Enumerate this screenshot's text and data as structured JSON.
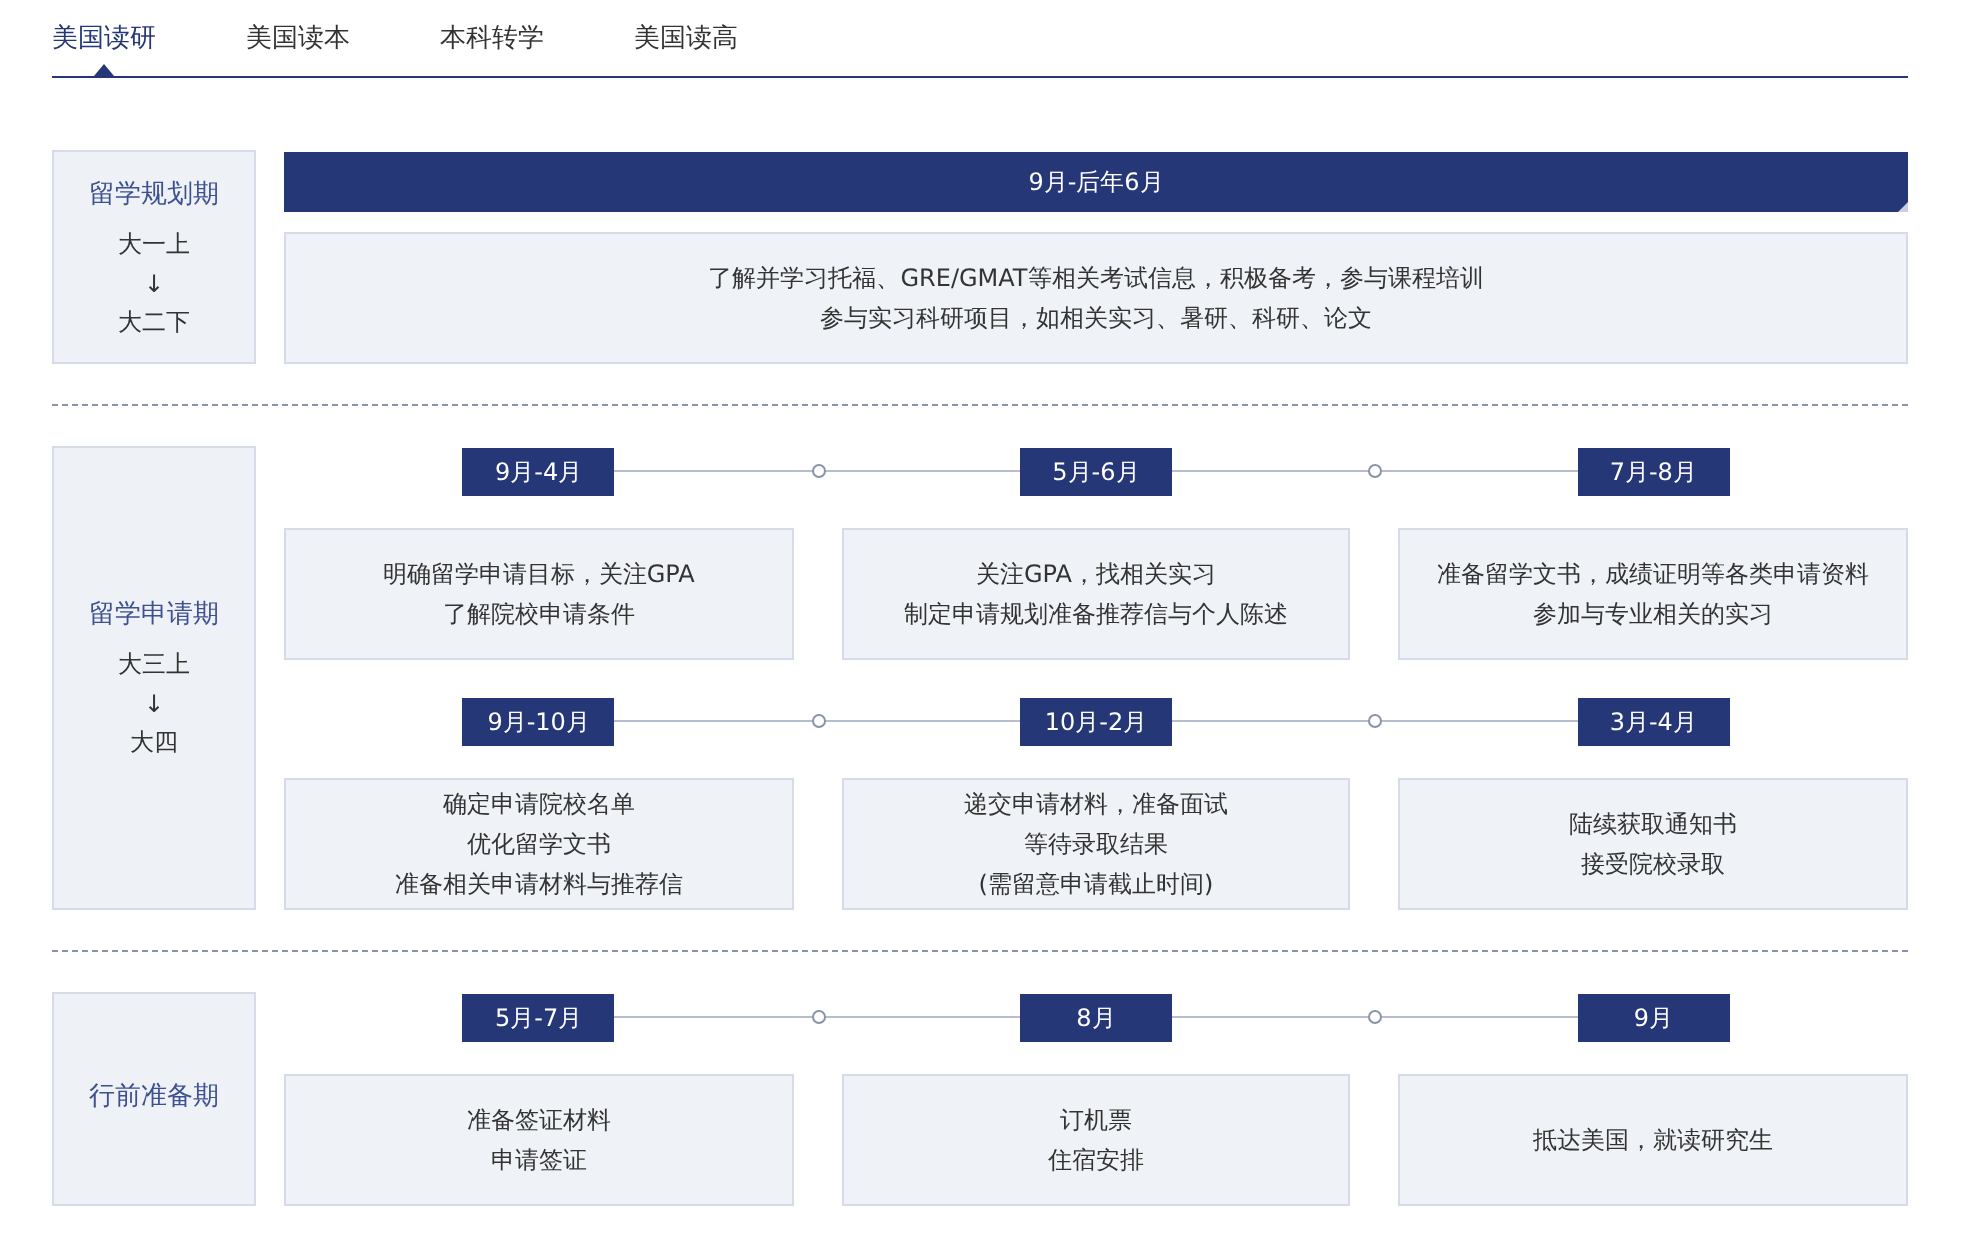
{
  "tabs": [
    {
      "label": "美国读研",
      "selected": true
    },
    {
      "label": "美国读本",
      "selected": false
    },
    {
      "label": "本科转学",
      "selected": false
    },
    {
      "label": "美国读高",
      "selected": false
    }
  ],
  "stages": [
    {
      "kind": "banner",
      "title": "留学规划期",
      "span": [
        "大一上",
        "↓",
        "大二下"
      ],
      "period": "9月-后年6月",
      "lines": [
        "了解并学习托福、GRE/GMAT等相关考试信息，积极备考，参与课程培训",
        "参与实习科研项目，如相关实习、暑研、科研、论文"
      ]
    },
    {
      "kind": "timeline",
      "title": "留学申请期",
      "span": [
        "大三上",
        "↓",
        "大四"
      ],
      "rows": [
        {
          "items": [
            {
              "period": "9月-4月",
              "lines": [
                "明确留学申请目标，关注GPA",
                "了解院校申请条件"
              ]
            },
            {
              "period": "5月-6月",
              "lines": [
                "关注GPA，找相关实习",
                "制定申请规划准备推荐信与个人陈述"
              ]
            },
            {
              "period": "7月-8月",
              "lines": [
                "准备留学文书，成绩证明等各类申请资料",
                "参加与专业相关的实习"
              ]
            }
          ]
        },
        {
          "items": [
            {
              "period": "9月-10月",
              "lines": [
                "确定申请院校名单",
                "优化留学文书",
                "准备相关申请材料与推荐信"
              ]
            },
            {
              "period": "10月-2月",
              "lines": [
                "递交申请材料，准备面试",
                "等待录取结果",
                "(需留意申请截止时间)"
              ]
            },
            {
              "period": "3月-4月",
              "lines": [
                "陆续获取通知书",
                "接受院校录取"
              ]
            }
          ]
        }
      ]
    },
    {
      "kind": "timeline",
      "title": "行前准备期",
      "rows": [
        {
          "items": [
            {
              "period": "5月-7月",
              "lines": [
                "准备签证材料",
                "申请签证"
              ]
            },
            {
              "period": "8月",
              "lines": [
                "订机票",
                "住宿安排"
              ]
            },
            {
              "period": "9月",
              "lines": [
                "抵达美国，就读研究生"
              ]
            }
          ]
        }
      ]
    }
  ]
}
